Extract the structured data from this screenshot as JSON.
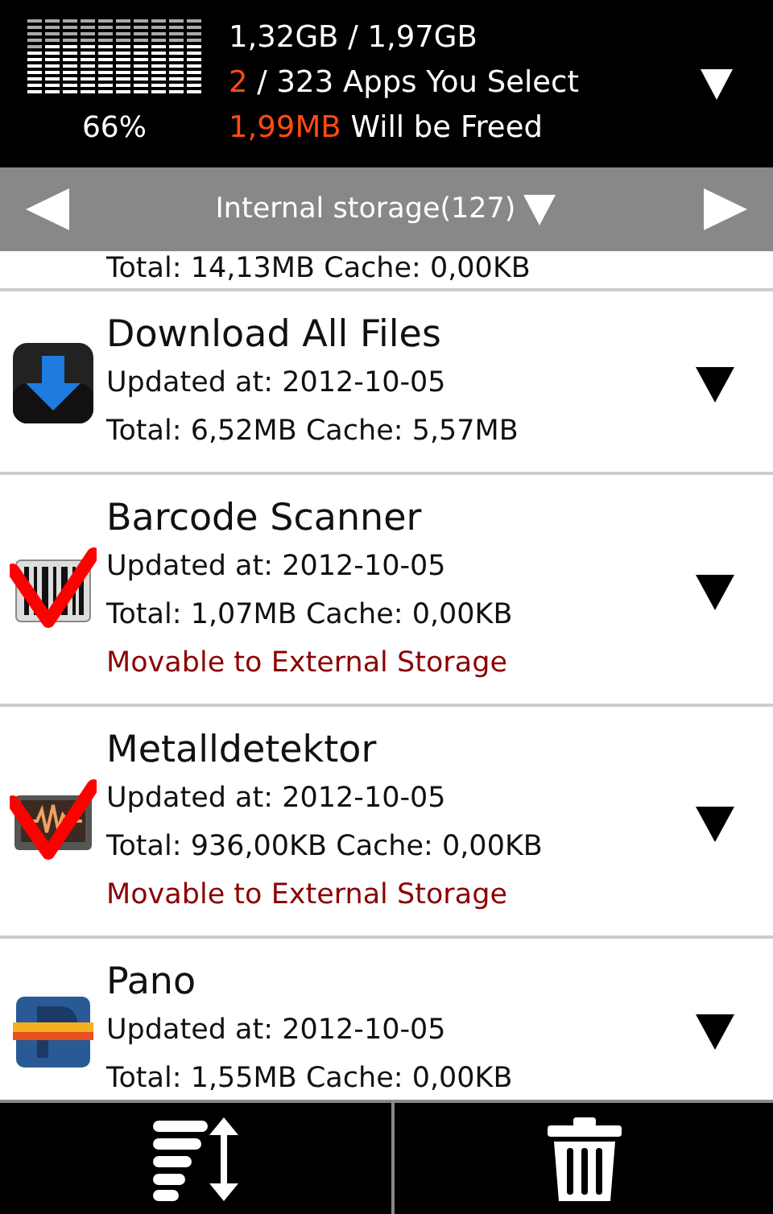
{
  "header": {
    "percent": "66%",
    "usage": "1,32GB / 1,97GB",
    "selected_count": "2",
    "selected_text": "/ 323 Apps You Select",
    "freed_size": "1,99MB",
    "freed_text": "Will be Freed"
  },
  "storage_bar": {
    "title": "Internal storage(127)"
  },
  "partial_row": {
    "details": "Total: 14,13MB Cache: 0,00KB"
  },
  "apps": [
    {
      "name": "Download All Files",
      "kind": "download",
      "selected": false,
      "updated": "Updated at: 2012-10-05",
      "sizes": "Total: 6,52MB Cache: 5,57MB"
    },
    {
      "name": "Barcode Scanner",
      "kind": "barcode",
      "selected": true,
      "updated": "Updated at: 2012-10-05",
      "sizes": "Total: 1,07MB Cache: 0,00KB",
      "note": "Movable to External Storage"
    },
    {
      "name": "Metalldetektor",
      "kind": "detector",
      "selected": true,
      "updated": "Updated at: 2012-10-05",
      "sizes": "Total: 936,00KB Cache: 0,00KB",
      "note": "Movable to External Storage"
    },
    {
      "name": "Pano",
      "kind": "pano",
      "selected": false,
      "updated": "Updated at: 2012-10-05",
      "sizes": "Total: 1,55MB Cache: 0,00KB"
    }
  ]
}
